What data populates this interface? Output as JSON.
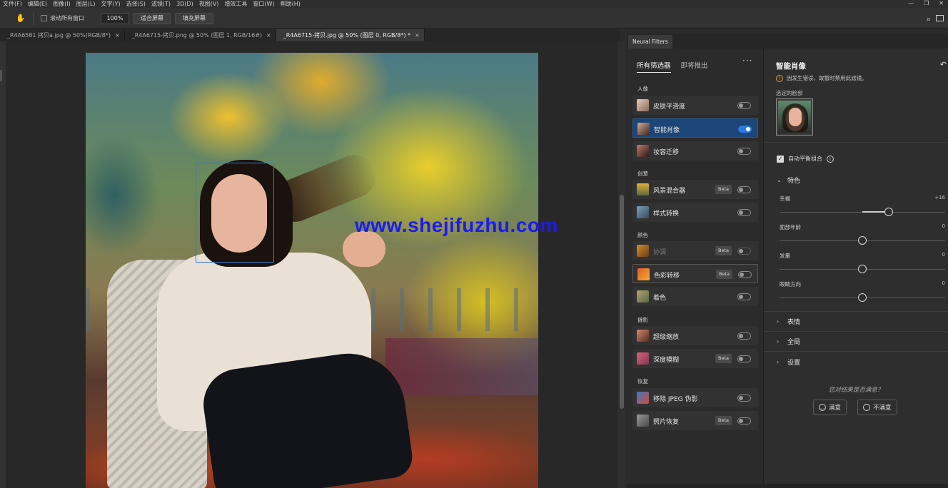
{
  "menu": [
    "文件(F)",
    "编辑(E)",
    "图像(I)",
    "图层(L)",
    "文字(Y)",
    "选择(S)",
    "滤镜(T)",
    "3D(D)",
    "视图(V)",
    "增效工具",
    "窗口(W)",
    "帮助(H)"
  ],
  "window_controls": {
    "minimize": "—",
    "restore": "❐",
    "close": "✕"
  },
  "options": {
    "scroll_all_windows": "滚动所有窗口",
    "scroll_all_checked": false,
    "zoom": "100%",
    "fit_screen": "适合屏幕",
    "fill_screen": "填充屏幕"
  },
  "tabs": [
    {
      "label": "_R4A6581 拷贝a.jpg @ 50%(RGB/8*)",
      "close": "×",
      "active": false
    },
    {
      "label": "_R4A6715-拷贝.png @ 50% (图层 1, RGB/16#)",
      "close": "×",
      "active": false
    },
    {
      "label": "_R4A6715-拷贝.jpg @ 50% (图层 0, RGB/8*) *",
      "close": "×",
      "active": true
    }
  ],
  "watermark": "www.shejifuzhu.com",
  "neural_filters": {
    "panel_tab": "Neural Filters",
    "tab_all": "所有筛选器",
    "tab_upcoming": "即将推出",
    "more": "···",
    "sections": [
      {
        "title": "人像",
        "items": [
          {
            "label": "皮肤平滑度",
            "beta": "",
            "on": false
          },
          {
            "label": "智能肖像",
            "beta": "",
            "on": true
          },
          {
            "label": "妆容迁移",
            "beta": "",
            "on": false
          }
        ]
      },
      {
        "title": "创意",
        "items": [
          {
            "label": "风景混合器",
            "beta": "Beta",
            "on": false
          },
          {
            "label": "样式转换",
            "beta": "",
            "on": false
          }
        ]
      },
      {
        "title": "颜色",
        "items": [
          {
            "label": "协调",
            "beta": "Beta",
            "on": false
          },
          {
            "label": "色彩转移",
            "beta": "Beta",
            "on": false
          },
          {
            "label": "着色",
            "beta": "",
            "on": false
          }
        ]
      },
      {
        "title": "摄影",
        "items": [
          {
            "label": "超级缩放",
            "beta": "",
            "on": false
          },
          {
            "label": "深度模糊",
            "beta": "Beta",
            "on": false
          }
        ]
      },
      {
        "title": "恢复",
        "items": [
          {
            "label": "移除 JPEG 伪影",
            "beta": "",
            "on": false
          },
          {
            "label": "照片恢复",
            "beta": "Beta",
            "on": false
          }
        ]
      }
    ]
  },
  "detail": {
    "title": "智能肖像",
    "warning": "因发生错误，故暂时禁用此滤镜。",
    "selected_face_label": "选定的脸部",
    "auto_balance": "自动平衡组合",
    "auto_balance_checked": true,
    "features_group": "特色",
    "sliders": [
      {
        "name": "幸福",
        "value": "+16",
        "level": 0.66
      },
      {
        "name": "面部年龄",
        "value": "0",
        "level": 0.5
      },
      {
        "name": "发量",
        "value": "0",
        "level": 0.5
      },
      {
        "name": "眼睛方向",
        "value": "0",
        "level": 0.5
      }
    ],
    "groups": [
      "表情",
      "全局",
      "设置"
    ],
    "feedback_question": "您对结果是否满意？",
    "satisfied": "满意",
    "unsatisfied": "不满意"
  }
}
